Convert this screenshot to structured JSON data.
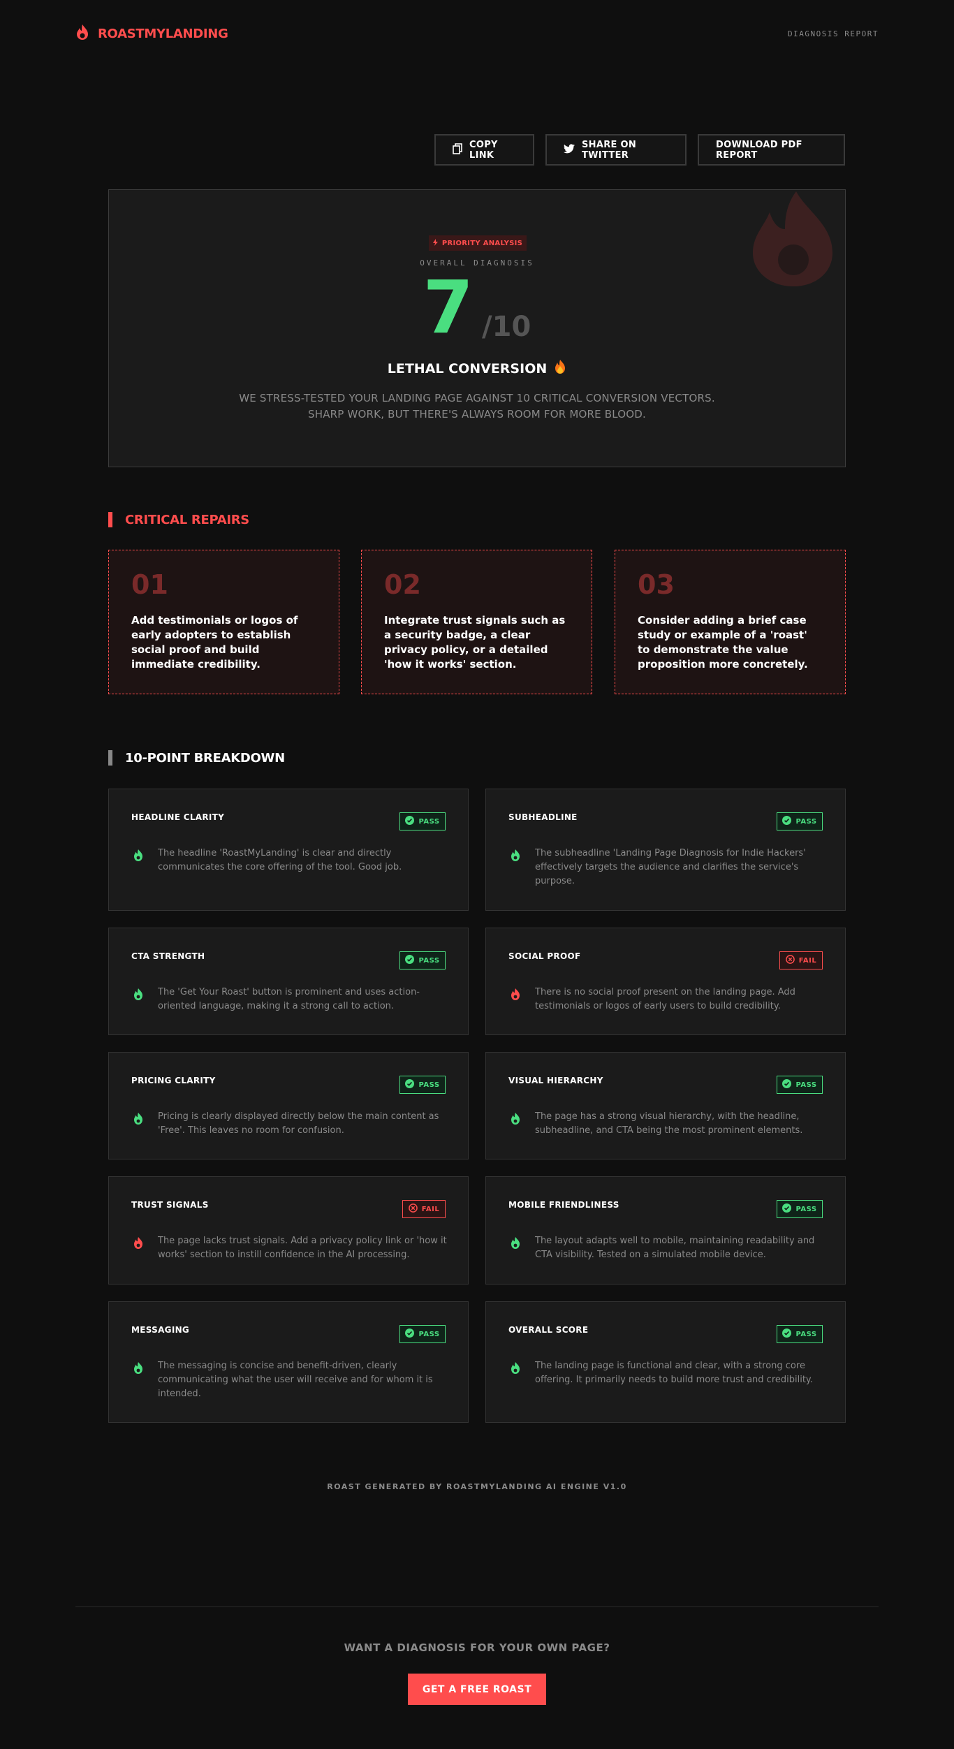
{
  "header": {
    "brand": "ROASTMYLANDING",
    "report_label": "DIAGNOSIS REPORT"
  },
  "actions": {
    "copy_link": "COPY LINK",
    "share_twitter": "SHARE ON TWITTER",
    "download_pdf": "DOWNLOAD PDF REPORT"
  },
  "hero": {
    "badge": "PRIORITY ANALYSIS",
    "label": "OVERALL DIAGNOSIS",
    "score": "7",
    "score_max": "/10",
    "verdict": "LETHAL CONVERSION",
    "description": "WE STRESS-TESTED YOUR LANDING PAGE AGAINST 10 CRITICAL CONVERSION VECTORS. SHARP WORK, BUT THERE'S ALWAYS ROOM FOR MORE BLOOD."
  },
  "repairs": {
    "title": "CRITICAL REPAIRS",
    "items": [
      {
        "num": "01",
        "text": "Add testimonials or logos of early adopters to establish social proof and build immediate credibility."
      },
      {
        "num": "02",
        "text": "Integrate trust signals such as a security badge, a clear privacy policy, or a detailed 'how it works' section."
      },
      {
        "num": "03",
        "text": "Consider adding a brief case study or example of a 'roast' to demonstrate the value proposition more concretely."
      }
    ]
  },
  "breakdown": {
    "title": "10-POINT BREAKDOWN",
    "items": [
      {
        "title": "HEADLINE CLARITY",
        "status": "PASS",
        "text": "The headline 'RoastMyLanding' is clear and directly communicates the core offering of the tool. Good job."
      },
      {
        "title": "SUBHEADLINE",
        "status": "PASS",
        "text": "The subheadline 'Landing Page Diagnosis for Indie Hackers' effectively targets the audience and clarifies the service's purpose."
      },
      {
        "title": "CTA STRENGTH",
        "status": "PASS",
        "text": "The 'Get Your Roast' button is prominent and uses action-oriented language, making it a strong call to action."
      },
      {
        "title": "SOCIAL PROOF",
        "status": "FAIL",
        "text": "There is no social proof present on the landing page. Add testimonials or logos of early users to build credibility."
      },
      {
        "title": "PRICING CLARITY",
        "status": "PASS",
        "text": "Pricing is clearly displayed directly below the main content as 'Free'. This leaves no room for confusion."
      },
      {
        "title": "VISUAL HIERARCHY",
        "status": "PASS",
        "text": "The page has a strong visual hierarchy, with the headline, subheadline, and CTA being the most prominent elements."
      },
      {
        "title": "TRUST SIGNALS",
        "status": "FAIL",
        "text": "The page lacks trust signals. Add a privacy policy link or 'how it works' section to instill confidence in the AI processing."
      },
      {
        "title": "MOBILE FRIENDLINESS",
        "status": "PASS",
        "text": "The layout adapts well to mobile, maintaining readability and CTA visibility. Tested on a simulated mobile device."
      },
      {
        "title": "MESSAGING",
        "status": "PASS",
        "text": "The messaging is concise and benefit-driven, clearly communicating what the user will receive and for whom it is intended."
      },
      {
        "title": "OVERALL SCORE",
        "status": "PASS",
        "text": "The landing page is functional and clear, with a strong core offering. It primarily needs to build more trust and credibility."
      }
    ]
  },
  "footer": {
    "note": "ROAST GENERATED BY ROASTMYLANDING AI ENGINE V1.0",
    "cta_question": "WANT A DIAGNOSIS FOR YOUR OWN PAGE?",
    "cta_button": "GET A FREE ROAST"
  },
  "colors": {
    "accent": "#ff4d4d",
    "pass": "#4ade80",
    "background": "#0f0f0f",
    "card": "#1b1b1b"
  },
  "icons": {
    "brand": "flame-icon",
    "copy": "copy-icon",
    "twitter": "twitter-icon",
    "badge": "bolt-icon",
    "verdict": "fire-emoji-icon",
    "pass": "check-circle-icon",
    "fail": "x-circle-icon",
    "card": "flame-icon"
  }
}
